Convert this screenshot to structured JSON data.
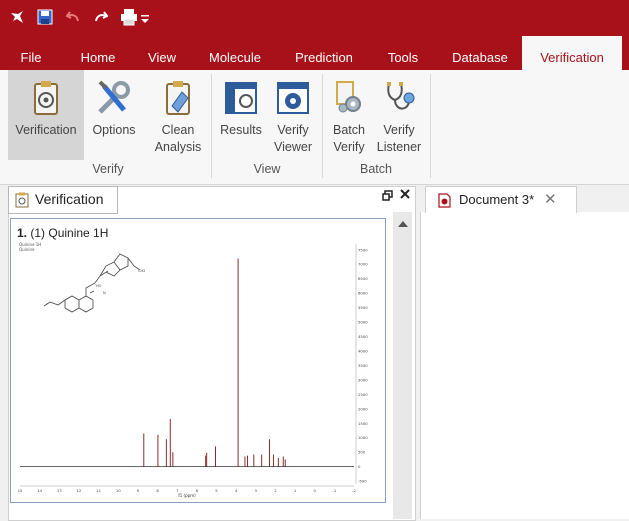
{
  "quick_access": {
    "app_icon": "app-logo-icon",
    "save_icon": "save-icon",
    "undo_icon": "undo-icon",
    "redo_icon": "redo-icon",
    "print_icon": "print-icon",
    "customize_icon": "customize-toolbar-icon"
  },
  "ribbon_tabs": [
    "File",
    "Home",
    "View",
    "Molecule",
    "Prediction",
    "Tools",
    "Database",
    "Verification"
  ],
  "active_tab": "Verification",
  "ribbon": {
    "groups": [
      {
        "label": "Verify",
        "buttons": [
          {
            "label": "Verification",
            "icon": "verification-clipboard-icon",
            "active": true
          },
          {
            "label": "Options",
            "icon": "wrench-screwdriver-icon"
          },
          {
            "label": "Clean Analysis",
            "icon": "eraser-clipboard-icon"
          }
        ]
      },
      {
        "label": "View",
        "buttons": [
          {
            "label": "Results",
            "icon": "results-icon"
          },
          {
            "label": "Verify Viewer",
            "icon": "verify-viewer-icon"
          }
        ]
      },
      {
        "label": "Batch",
        "buttons": [
          {
            "label": "Batch Verify",
            "icon": "batch-verify-gears-icon"
          },
          {
            "label": "Verify Listener",
            "icon": "stethoscope-icon"
          }
        ]
      }
    ]
  },
  "left_panel": {
    "tab_label": "Verification",
    "tab_icon": "verification-clipboard-icon",
    "float_icon": "float-window-icon",
    "close_icon": "close-icon",
    "spectrum_title_number": "1.",
    "spectrum_title_text": "(1) Quinine 1H",
    "spectrum_legend": [
      "Quinine 1H",
      "Quinine"
    ],
    "spectrum_x_label": "f1 (ppm)"
  },
  "document_tab": {
    "label": "Document 3*",
    "icon": "document-icon",
    "close_icon": "close-icon"
  },
  "colors": {
    "ribbon_red": "#a8111a",
    "spectrum_peak": "#8b2d2d",
    "panel_border": "#8da0c0"
  },
  "chart_data": {
    "type": "line",
    "title": "",
    "xlabel": "f1 (ppm)",
    "ylabel": "",
    "x_ticks": [
      "15",
      "14",
      "13",
      "12",
      "11",
      "10",
      "9",
      "8",
      "7",
      "6",
      "5",
      "4",
      "3",
      "2",
      "1",
      "0",
      "-1",
      "-2"
    ],
    "y_ticks": [
      "7500",
      "7000",
      "6500",
      "6000",
      "5500",
      "5000",
      "4500",
      "4000",
      "3500",
      "3000",
      "2500",
      "2000",
      "1500",
      "1000",
      "500",
      "0",
      "-500"
    ],
    "xlim": [
      15,
      -2
    ],
    "ylim": [
      -600,
      7700
    ],
    "peaks": [
      {
        "x": 8.7,
        "y": 1150
      },
      {
        "x": 7.98,
        "y": 1100
      },
      {
        "x": 7.55,
        "y": 950
      },
      {
        "x": 7.35,
        "y": 1650
      },
      {
        "x": 7.22,
        "y": 500
      },
      {
        "x": 5.55,
        "y": 380
      },
      {
        "x": 5.5,
        "y": 480
      },
      {
        "x": 5.05,
        "y": 700
      },
      {
        "x": 3.9,
        "y": 7200
      },
      {
        "x": 3.55,
        "y": 350
      },
      {
        "x": 3.42,
        "y": 380
      },
      {
        "x": 3.1,
        "y": 420
      },
      {
        "x": 2.7,
        "y": 420
      },
      {
        "x": 2.3,
        "y": 950
      },
      {
        "x": 2.1,
        "y": 420
      },
      {
        "x": 1.85,
        "y": 300
      },
      {
        "x": 1.6,
        "y": 350
      },
      {
        "x": 1.5,
        "y": 250
      }
    ]
  }
}
